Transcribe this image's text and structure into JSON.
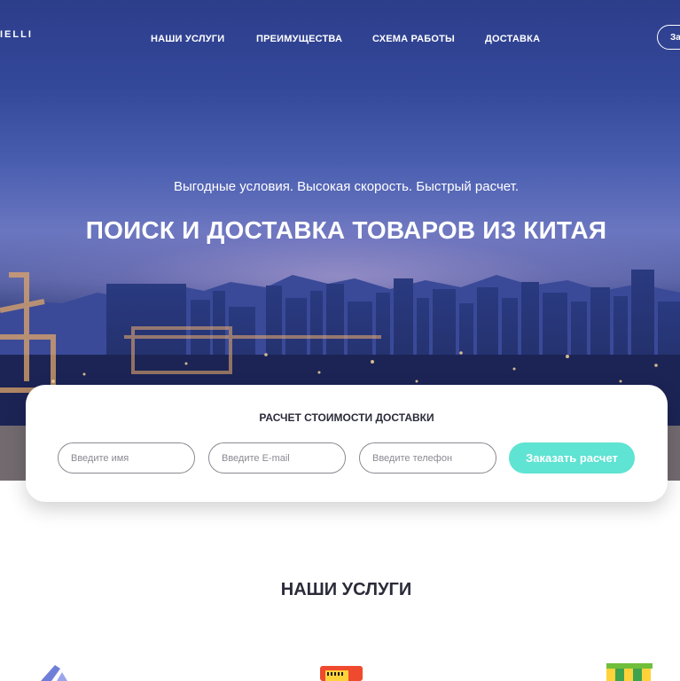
{
  "header": {
    "logo_text": "IELLI",
    "nav": [
      "НАШИ УСЛУГИ",
      "ПРЕИМУЩЕСТВА",
      "СХЕМА РАБОТЫ",
      "ДОСТАВКА"
    ],
    "cta_label": "За"
  },
  "hero": {
    "subtitle": "Выгодные условия. Высокая скорость. Быстрый расчет.",
    "headline": "ПОИСК И ДОСТАВКА ТОВАРОВ ИЗ КИТАЯ"
  },
  "calc_form": {
    "title": "РАСЧЕТ СТОИМОСТИ ДОСТАВКИ",
    "name_placeholder": "Введите имя",
    "email_placeholder": "Введите E-mail",
    "phone_placeholder": "Введите телефон",
    "submit_label": "Заказать расчет"
  },
  "services": {
    "title": "НАШИ УСЛУГИ",
    "icons": [
      "airplane-icon",
      "cash-register-icon",
      "shop-awning-icon"
    ]
  },
  "colors": {
    "accent": "#5fe3d2",
    "text_dark": "#2b2b3a",
    "hero_blue": "#34489a"
  }
}
